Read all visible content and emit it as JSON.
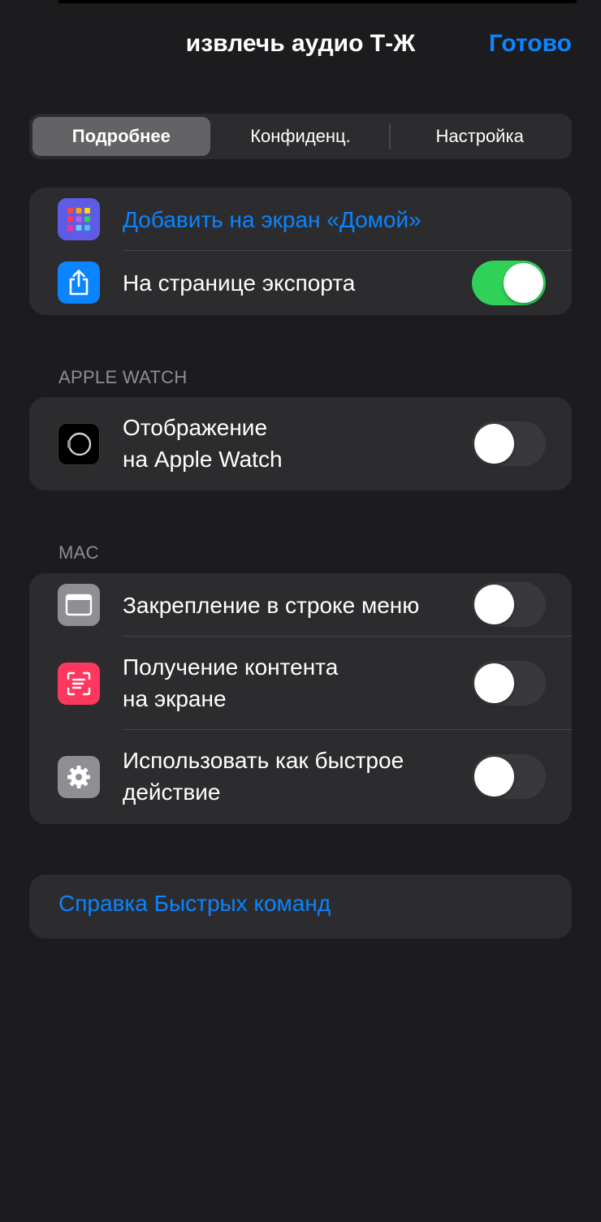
{
  "header": {
    "title": "извлечь аудио Т-Ж",
    "done_label": "Готово"
  },
  "tabs": [
    {
      "label": "Подробнее",
      "selected": true
    },
    {
      "label": "Конфиденц.",
      "selected": false
    },
    {
      "label": "Настройка",
      "selected": false
    }
  ],
  "general": {
    "add_home": {
      "label": "Добавить на экран «Домой»",
      "icon": "app-grid-icon"
    },
    "share_sheet": {
      "label": "На странице экспорта",
      "icon": "share-icon",
      "enabled": true
    }
  },
  "watch": {
    "header": "APPLE WATCH",
    "show_on_watch": {
      "line1": "Отображение",
      "line2": "на Apple Watch",
      "icon": "apple-watch-icon",
      "enabled": false
    }
  },
  "mac": {
    "header": "MAC",
    "menu_bar": {
      "label": "Закрепление в строке меню",
      "icon": "menu-bar-window-icon",
      "enabled": false
    },
    "screen_content": {
      "line1": "Получение контента",
      "line2": "на экране",
      "icon": "text-scan-icon",
      "enabled": false
    },
    "quick_action": {
      "line1": "Использовать как быстрое",
      "line2": "действие",
      "icon": "gear-icon",
      "enabled": false
    }
  },
  "help": {
    "label": "Справка Быстрых команд"
  },
  "colors": {
    "background": "#1c1c1e",
    "cell": "#2c2c2e",
    "accent": "#0a84ff",
    "toggle_on": "#30d158",
    "toggle_off": "#39393d",
    "secondary_text": "#8e8e93"
  }
}
